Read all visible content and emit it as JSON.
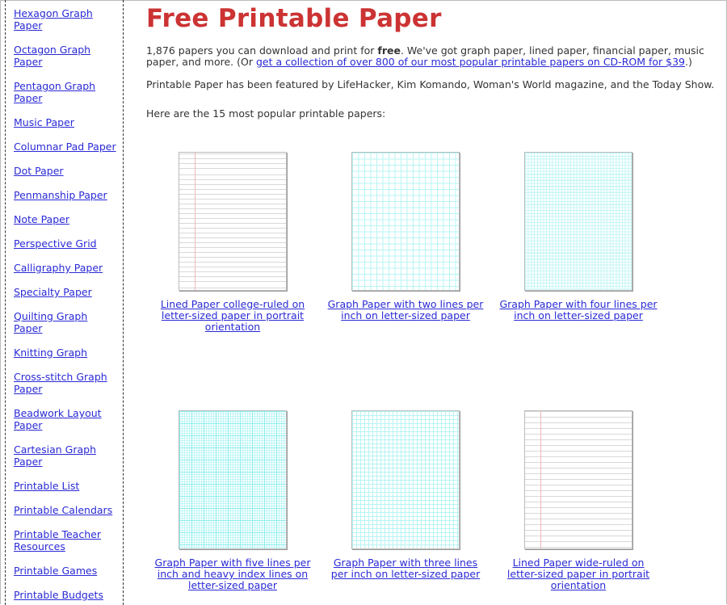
{
  "sidebar": {
    "items": [
      {
        "label": "Hexagon Graph Paper"
      },
      {
        "label": "Octagon Graph Paper"
      },
      {
        "label": "Pentagon Graph Paper"
      },
      {
        "label": "Music Paper"
      },
      {
        "label": "Columnar Pad Paper"
      },
      {
        "label": "Dot Paper"
      },
      {
        "label": "Penmanship Paper"
      },
      {
        "label": "Note Paper"
      },
      {
        "label": "Perspective Grid"
      },
      {
        "label": "Calligraphy Paper"
      },
      {
        "label": "Specialty Paper"
      },
      {
        "label": "Quilting Graph Paper"
      },
      {
        "label": "Knitting Graph"
      },
      {
        "label": "Cross-stitch Graph Paper"
      },
      {
        "label": "Beadwork Layout Paper"
      },
      {
        "label": "Cartesian Graph Paper"
      },
      {
        "label": "Printable List"
      },
      {
        "label": "Printable Calendars"
      },
      {
        "label": "Printable Teacher Resources"
      },
      {
        "label": "Printable Games"
      },
      {
        "label": "Printable Budgets"
      }
    ]
  },
  "main": {
    "title": "Free Printable Paper",
    "intro_part1": "1,876 papers you can download and print for ",
    "intro_bold": "free",
    "intro_part2": ". We've got graph paper, lined paper, financial paper, music paper, and more. (Or ",
    "intro_link": "get a collection of over 800 of our most popular printable papers on CD-ROM for $39",
    "intro_part3": ".)",
    "featured": "Printable Paper has been featured by LifeHacker, Kim Komando, Woman's World magazine, and the Today Show.",
    "popular_heading": "Here are the 15 most popular printable papers:",
    "papers": [
      {
        "caption": "Lined Paper college-ruled on letter-sized paper in portrait orientation",
        "thumb": "lined-paper-thumbnail"
      },
      {
        "caption": "Graph Paper with two lines per inch on letter-sized paper",
        "thumb": "graph-paper-thumbnail"
      },
      {
        "caption": "Graph Paper with four lines per inch on letter-sized paper",
        "thumb": "graph-paper-thumbnail"
      },
      {
        "caption": "Graph Paper with five lines per inch and heavy index lines on letter-sized paper",
        "thumb": "graph-paper-thumbnail"
      },
      {
        "caption": "Graph Paper with three lines per inch on letter-sized paper",
        "thumb": "graph-paper-thumbnail"
      },
      {
        "caption": "Lined Paper wide-ruled on letter-sized paper in portrait orientation",
        "thumb": "lined-paper-thumbnail"
      }
    ]
  }
}
